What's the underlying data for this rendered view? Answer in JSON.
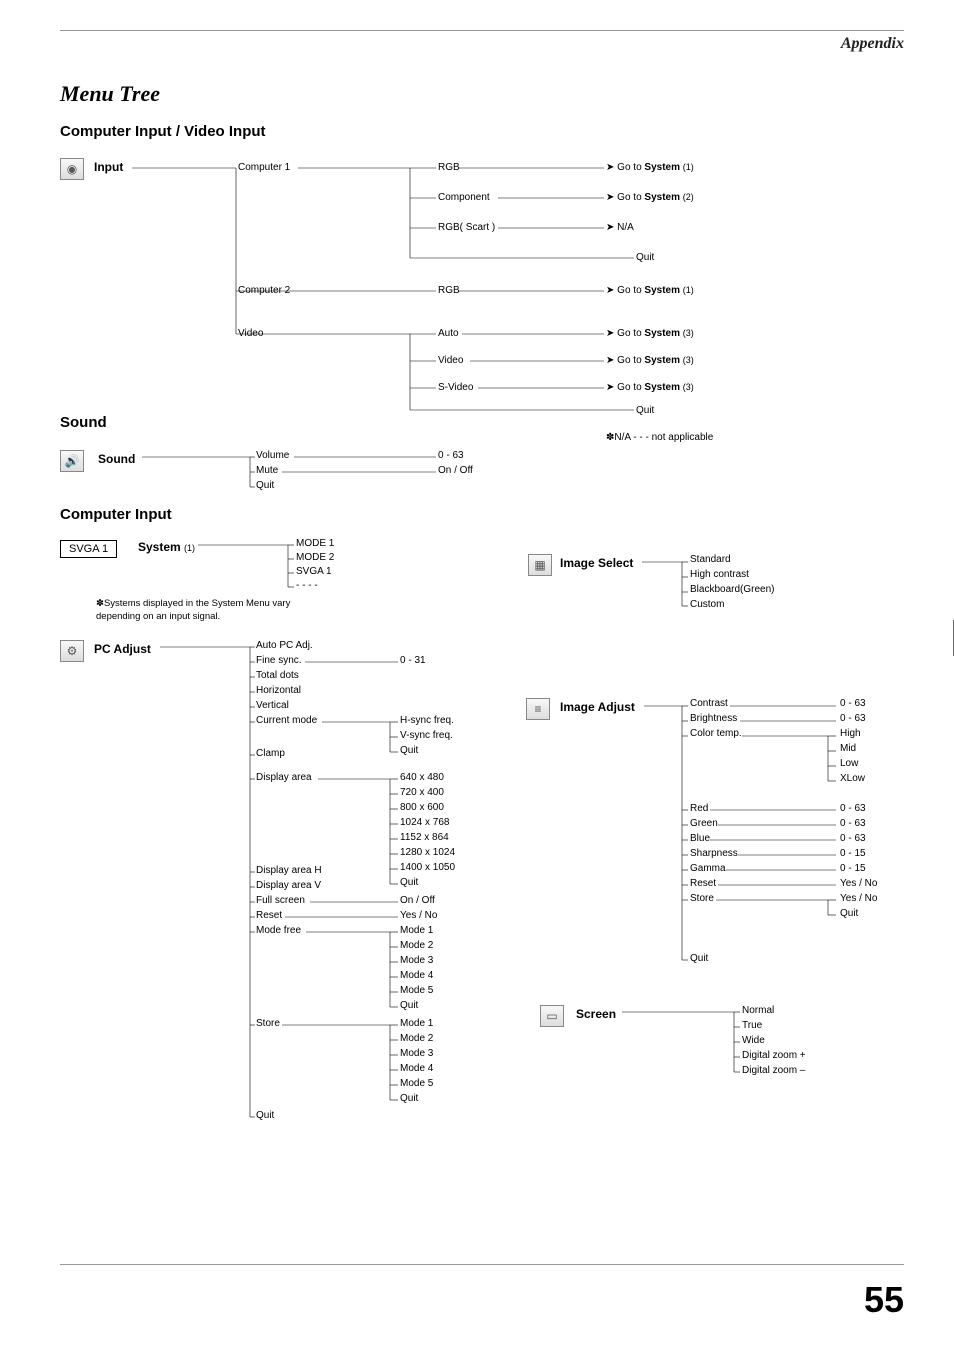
{
  "header": {
    "appendix": "Appendix"
  },
  "title": "Menu Tree",
  "subtitle": "Computer Input / Video Input",
  "sections": {
    "input": "Input",
    "sound": "Sound",
    "sound2": "Sound",
    "computer_input": "Computer Input",
    "system": "System",
    "system_sub": "(1)",
    "pc_adjust": "PC Adjust",
    "image_select": "Image Select",
    "image_adjust": "Image Adjust",
    "screen": "Screen"
  },
  "svga": "SVGA 1",
  "input_tree": {
    "computer1": "Computer 1",
    "computer2": "Computer 2",
    "video": "Video",
    "rgb": "RGB",
    "component": "Component",
    "rgb_scart": "RGB( Scart )",
    "na": "N/A",
    "quit": "Quit",
    "auto": "Auto",
    "video2": "Video",
    "svideo": "S-Video",
    "go_system": "Go to",
    "system_word": "System",
    "s1": "(1)",
    "s2": "(2)",
    "s3": "(3)"
  },
  "sound_tree": {
    "volume": "Volume",
    "mute": "Mute",
    "quit": "Quit",
    "vol_range": "0 - 63",
    "mute_val": "On / Off"
  },
  "na_note": "✽N/A - - - not applicable",
  "system_tree": {
    "mode1": "MODE 1",
    "mode2": "MODE 2",
    "svga1": "SVGA 1",
    "dots": "- - - -"
  },
  "system_note": "✽Systems displayed in the System Menu vary depending on an input signal.",
  "pc_adjust_tree": {
    "auto_pc": "Auto PC Adj.",
    "fine_sync": "Fine sync.",
    "fine_sync_range": "0 - 31",
    "total_dots": "Total dots",
    "horizontal": "Horizontal",
    "vertical": "Vertical",
    "current_mode": "Current mode",
    "hsync": "H-sync freq.",
    "vsync": "V-sync freq.",
    "quit": "Quit",
    "clamp": "Clamp",
    "display_area": "Display area",
    "res": [
      "640 x 480",
      "720 x 400",
      "800 x 600",
      "1024 x 768",
      "1152 x 864",
      "1280 x 1024",
      "1400 x 1050"
    ],
    "display_area_h": "Display area H",
    "display_area_v": "Display area V",
    "full_screen": "Full screen",
    "full_screen_val": "On / Off",
    "reset": "Reset",
    "reset_val": "Yes / No",
    "mode_free": "Mode free",
    "modes": [
      "Mode 1",
      "Mode 2",
      "Mode 3",
      "Mode 4",
      "Mode 5"
    ],
    "store": "Store"
  },
  "image_select_tree": {
    "standard": "Standard",
    "high_contrast": "High contrast",
    "blackboard": "Blackboard(Green)",
    "custom": "Custom"
  },
  "image_adjust_tree": {
    "contrast": "Contrast",
    "brightness": "Brightness",
    "color_temp": "Color temp.",
    "high": "High",
    "mid": "Mid",
    "low": "Low",
    "xlow": "XLow",
    "red": "Red",
    "green": "Green",
    "blue": "Blue",
    "sharpness": "Sharpness",
    "gamma": "Gamma",
    "reset": "Reset",
    "store": "Store",
    "quit": "Quit",
    "r063": "0 - 63",
    "r015": "0 - 15",
    "yesno": "Yes / No"
  },
  "screen_tree": {
    "normal": "Normal",
    "true": "True",
    "wide": "Wide",
    "dz_plus": "Digital zoom +",
    "dz_minus": "Digital zoom –"
  },
  "page_number": "55"
}
